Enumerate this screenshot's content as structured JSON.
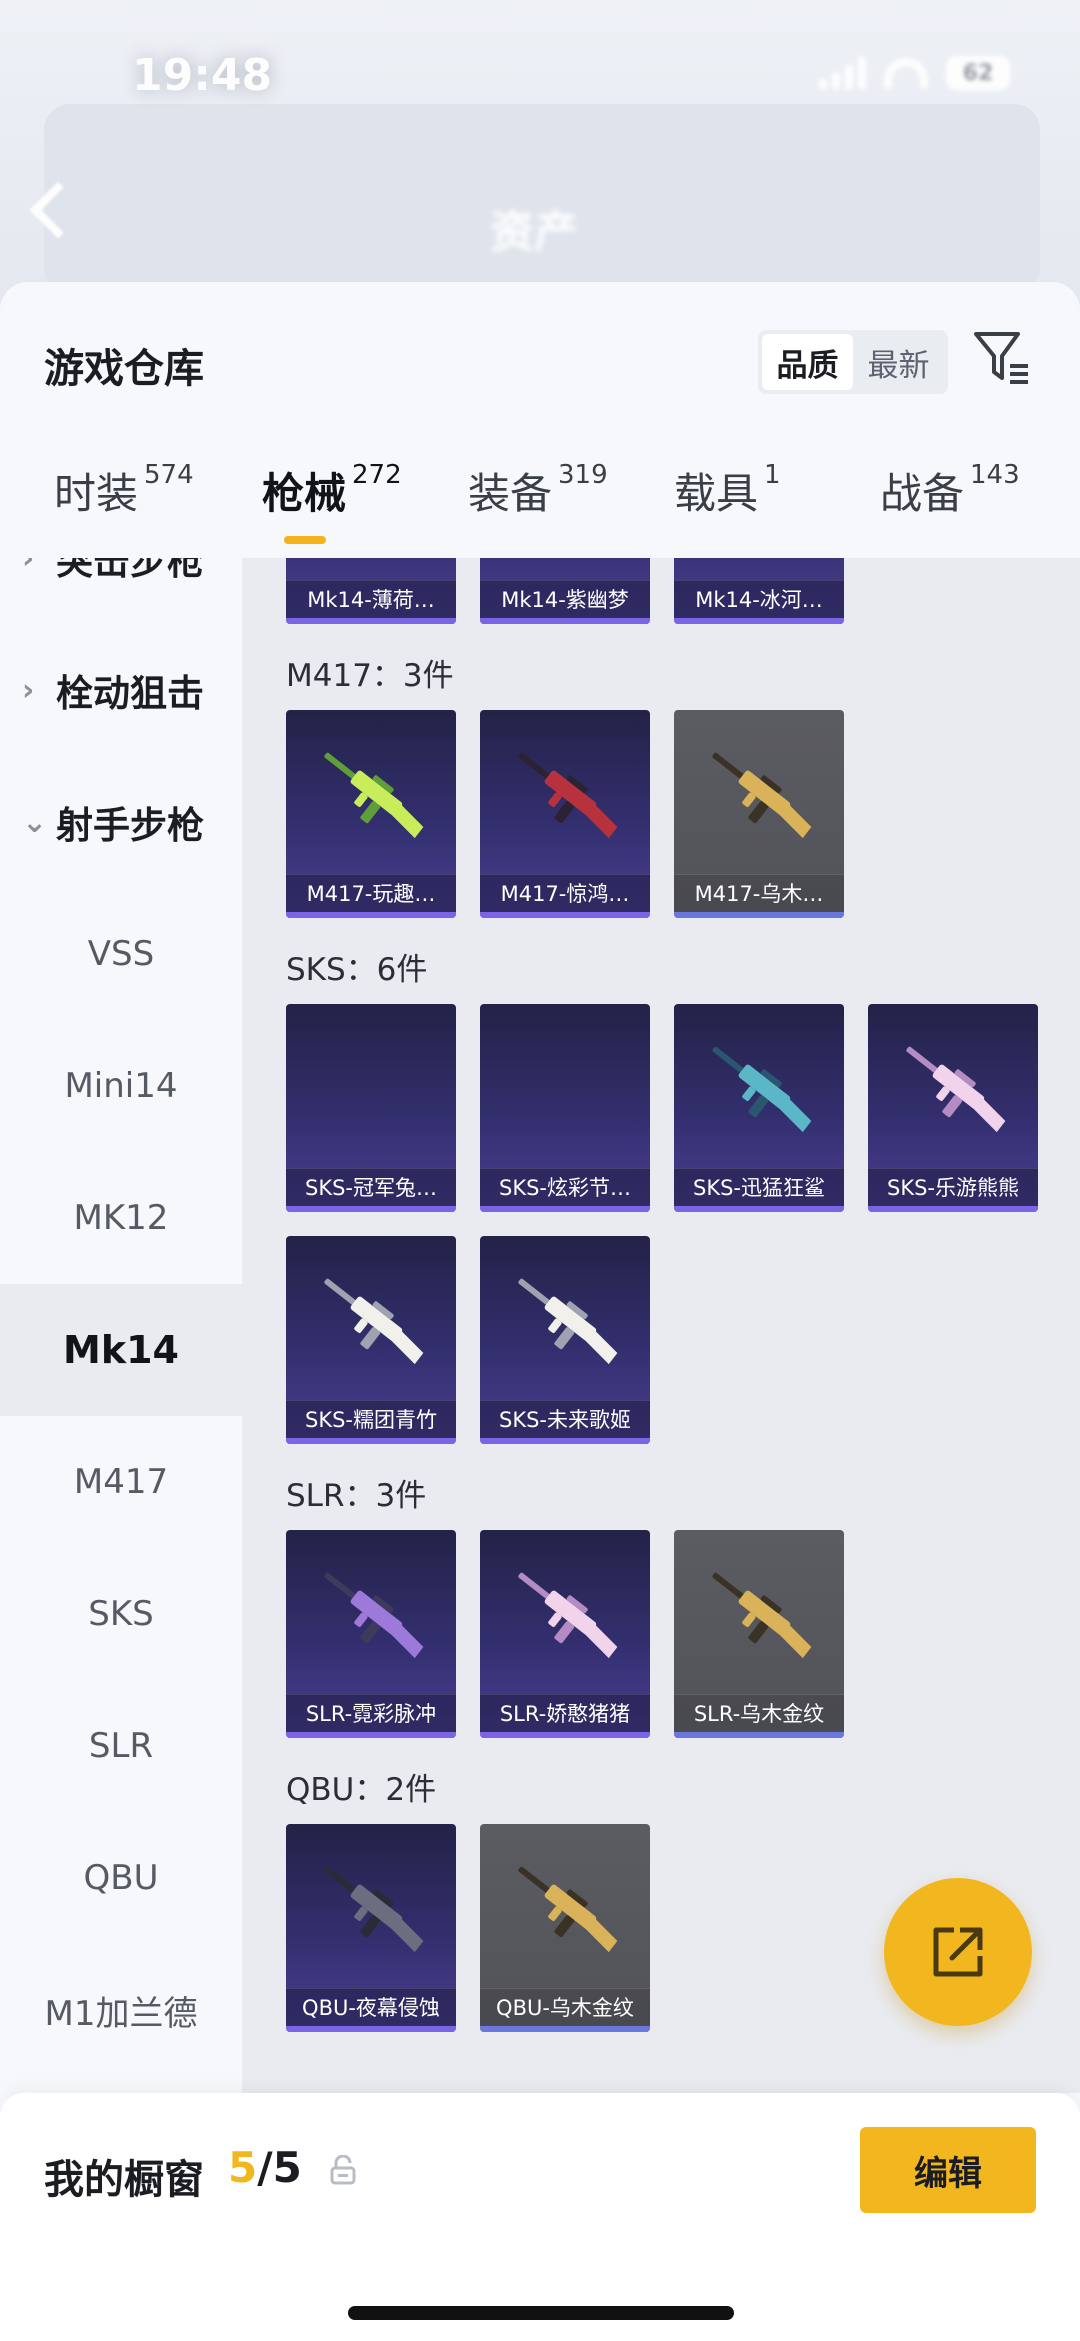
{
  "status_bar": {
    "time": "19:48",
    "battery": "62"
  },
  "header": {
    "title": "资产"
  },
  "warehouse": {
    "title": "游戏仓库",
    "sort_options": [
      {
        "label": "品质",
        "active": true
      },
      {
        "label": "最新",
        "active": false
      }
    ]
  },
  "tabs": [
    {
      "label": "时装",
      "count": "574",
      "active": false
    },
    {
      "label": "枪械",
      "count": "272",
      "active": true
    },
    {
      "label": "装备",
      "count": "319",
      "active": false
    },
    {
      "label": "载具",
      "count": "1",
      "active": false
    },
    {
      "label": "战备",
      "count": "143",
      "active": false
    }
  ],
  "sidebar": {
    "items": [
      {
        "label": "突击步枪",
        "group": true,
        "expanded": false
      },
      {
        "label": "栓动狙击",
        "group": true,
        "expanded": false
      },
      {
        "label": "射手步枪",
        "group": true,
        "expanded": true
      },
      {
        "label": "VSS",
        "group": false
      },
      {
        "label": "Mini14",
        "group": false
      },
      {
        "label": "MK12",
        "group": false
      },
      {
        "label": "Mk14",
        "group": false,
        "active": true
      },
      {
        "label": "M417",
        "group": false
      },
      {
        "label": "SKS",
        "group": false
      },
      {
        "label": "SLR",
        "group": false
      },
      {
        "label": "QBU",
        "group": false
      },
      {
        "label": "M1加兰德",
        "group": false
      }
    ]
  },
  "grid": {
    "sections": [
      {
        "heading": "",
        "items": [
          {
            "label": "Mk14-薄荷…",
            "style": "purple",
            "weapon": "rifle-mint"
          },
          {
            "label": "Mk14-紫幽梦",
            "style": "purple",
            "weapon": "rifle-white"
          },
          {
            "label": "Mk14-冰河…",
            "style": "purple",
            "weapon": "rifle-ice"
          }
        ]
      },
      {
        "heading": "M417：3件",
        "items": [
          {
            "label": "M417-玩趣…",
            "style": "purple",
            "weapon": "rifle-green"
          },
          {
            "label": "M417-惊鸿…",
            "style": "purple",
            "weapon": "rifle-red"
          },
          {
            "label": "M417-乌木…",
            "style": "gold",
            "weapon": "rifle-gold"
          }
        ]
      },
      {
        "heading": "SKS：6件",
        "items": [
          {
            "label": "SKS-冠军兔…",
            "style": "purple",
            "weapon": ""
          },
          {
            "label": "SKS-炫彩节…",
            "style": "purple",
            "weapon": ""
          },
          {
            "label": "SKS-迅猛狂鲨",
            "style": "purple",
            "weapon": "rifle-teal"
          },
          {
            "label": "SKS-乐游熊熊",
            "style": "purple",
            "weapon": "rifle-pink"
          },
          {
            "label": "SKS-糯团青竹",
            "style": "purple",
            "weapon": "rifle-white"
          },
          {
            "label": "SKS-未来歌姬",
            "style": "purple",
            "weapon": "rifle-white"
          }
        ]
      },
      {
        "heading": "SLR：3件",
        "items": [
          {
            "label": "SLR-霓彩脉冲",
            "style": "purple",
            "weapon": "rifle-neon"
          },
          {
            "label": "SLR-娇憨猪猪",
            "style": "purple",
            "weapon": "rifle-pink"
          },
          {
            "label": "SLR-乌木金纹",
            "style": "gold",
            "weapon": "rifle-gold"
          }
        ]
      },
      {
        "heading": "QBU：2件",
        "items": [
          {
            "label": "QBU-夜幕侵蚀",
            "style": "purple",
            "weapon": "rifle-dark"
          },
          {
            "label": "QBU-乌木金纹",
            "style": "gold",
            "weapon": "rifle-gold"
          }
        ]
      }
    ]
  },
  "showcase": {
    "title": "我的橱窗",
    "used": "5",
    "total": "/5",
    "edit_label": "编辑"
  },
  "colors": {
    "accent": "#f2b61f",
    "card_purple": "#332f6f",
    "card_gold": "#55565c",
    "rarity_bar": "#7b65e6"
  },
  "icons": [
    "back-arrow-icon",
    "filter-icon",
    "chevron-right-icon",
    "chevron-down-icon",
    "share-icon",
    "lock-icon"
  ]
}
